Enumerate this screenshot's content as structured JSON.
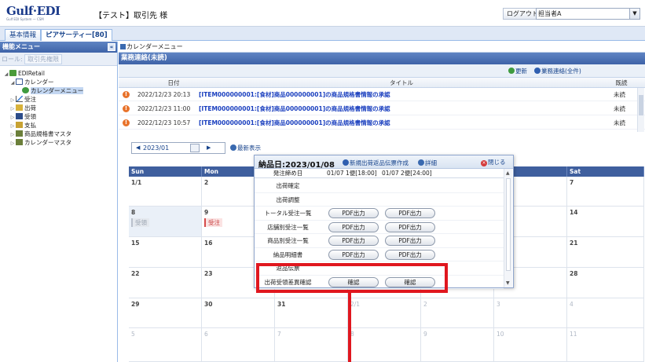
{
  "header": {
    "logo": "Gulf·EDI",
    "logo_sub": "Gulf EDI System — CSM",
    "company": "【テスト】取引先 様",
    "logout": "ログアウト",
    "user": "担当者A"
  },
  "tabs": [
    {
      "label": "基本情報"
    },
    {
      "label": "ピアサーティー[80]"
    }
  ],
  "left_panel": {
    "title": "機能メニュー",
    "role_label": "ロール:",
    "role_value": "取引先権限",
    "tree": [
      {
        "label": "EDIRetail",
        "icon": "folder-icon",
        "level": 0,
        "toggle": "◢"
      },
      {
        "label": "カレンダー",
        "icon": "calendar-icon",
        "level": 1,
        "toggle": "◢"
      },
      {
        "label": "カレンダーメニュー",
        "icon": "globe-icon",
        "level": 2,
        "toggle": ""
      },
      {
        "label": "受注",
        "icon": "chart-icon",
        "level": 1,
        "toggle": "▷"
      },
      {
        "label": "出荷",
        "icon": "truck-icon",
        "level": 1,
        "toggle": "▷"
      },
      {
        "label": "受領",
        "icon": "receive-icon",
        "level": 1,
        "toggle": "▷"
      },
      {
        "label": "支払",
        "icon": "payment-icon",
        "level": 1,
        "toggle": "▷"
      },
      {
        "label": "商品規格書マスタ",
        "icon": "master-icon",
        "level": 1,
        "toggle": "▷"
      },
      {
        "label": "カレンダーマスタ",
        "icon": "master-icon",
        "level": 1,
        "toggle": "▷"
      }
    ]
  },
  "breadcrumb": "カレンダーメニュー",
  "business": {
    "title": "業務連絡(未読)",
    "refresh": "更新",
    "all": "業務連絡(全件)",
    "columns": {
      "date": "日付",
      "title": "タイトル",
      "status": "既読"
    },
    "rows": [
      {
        "date": "2022/12/23 20:13",
        "title": "[ITEM000000001:[食材]商品000000001]の商品規格書情報の承認",
        "status": "未読"
      },
      {
        "date": "2022/12/23 11:00",
        "title": "[ITEM000000001:[食材]商品000000001]の商品規格書情報の承認",
        "status": "未読"
      },
      {
        "date": "2022/12/23 10:57",
        "title": "[ITEM000000001:[食材]商品000000001]の商品規格書情報の承認",
        "status": "未読"
      }
    ]
  },
  "calendar": {
    "month": "2023/01",
    "latest": "最新表示",
    "days": [
      "Sun",
      "Mon",
      "Tue",
      "Wed",
      "Thu",
      "Fri",
      "Sat"
    ],
    "weeks": [
      [
        "1/1",
        "2",
        "",
        "",
        "",
        "",
        "7"
      ],
      [
        "8",
        "9",
        "",
        "",
        "",
        "",
        "14"
      ],
      [
        "15",
        "16",
        "",
        "",
        "",
        "",
        "21"
      ],
      [
        "22",
        "23",
        "",
        "",
        "",
        "",
        "28"
      ],
      [
        "29",
        "30",
        "31",
        "2/1",
        "2",
        "3",
        "4"
      ],
      [
        "5",
        "6",
        "7",
        "8",
        "9",
        "10",
        "11"
      ]
    ],
    "tag_sun8": "受領",
    "tag_mon9": "受注"
  },
  "popup": {
    "title": "納品日:2023/01/08",
    "new_return": "新規出荷返品伝票作成",
    "detail": "詳細",
    "close": "閉じる",
    "col_order_close": "発注締め日",
    "col1": "01/07 1便[18:00]",
    "col2": "01/07 2便[24:00]",
    "rows": [
      {
        "label": "出荷確定",
        "btn1": "",
        "btn2": ""
      },
      {
        "label": "出荷調整",
        "btn1": "",
        "btn2": ""
      },
      {
        "label": "トータル受注一覧",
        "btn1": "PDF出力",
        "btn2": "PDF出力"
      },
      {
        "label": "店舗別受注一覧",
        "btn1": "PDF出力",
        "btn2": "PDF出力"
      },
      {
        "label": "商品別受注一覧",
        "btn1": "PDF出力",
        "btn2": "PDF出力"
      },
      {
        "label": "納品明細書",
        "btn1": "PDF出力",
        "btn2": "PDF出力"
      },
      {
        "label": "返品伝票",
        "btn1": "",
        "btn2": ""
      },
      {
        "label": "出荷受領差異確認",
        "btn1": "確認",
        "btn2": "確認"
      }
    ]
  },
  "colors": {
    "accent": "#3e63a8",
    "callout": "#e0171f",
    "link": "#1a3fbf"
  }
}
